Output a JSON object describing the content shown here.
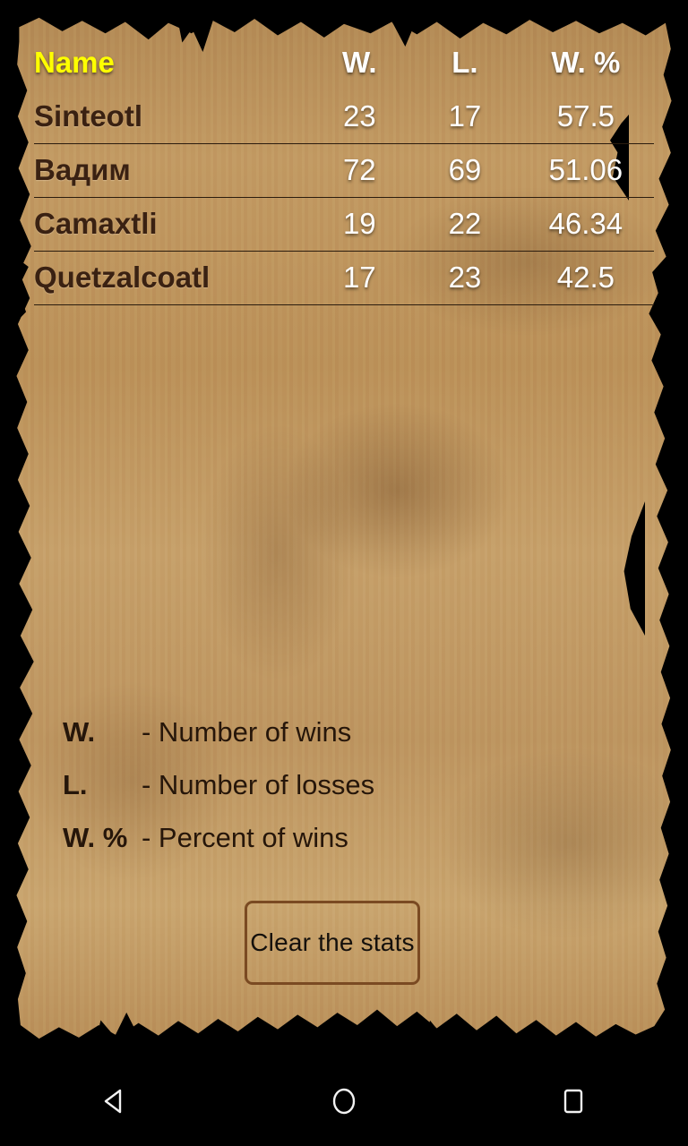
{
  "table": {
    "columns": [
      {
        "key": "name",
        "label": "Name",
        "accent": "#ffff00"
      },
      {
        "key": "w",
        "label": "W."
      },
      {
        "key": "l",
        "label": "L."
      },
      {
        "key": "pct",
        "label": "W. %"
      }
    ],
    "rows": [
      {
        "name": "Sinteotl",
        "w": "23",
        "l": "17",
        "pct": "57.5"
      },
      {
        "name": "Вадим",
        "w": "72",
        "l": "69",
        "pct": "51.06"
      },
      {
        "name": "Camaxtli",
        "w": "19",
        "l": "22",
        "pct": "46.34"
      },
      {
        "name": "Quetzalcoatl",
        "w": "17",
        "l": "23",
        "pct": "42.5"
      }
    ]
  },
  "legend": [
    {
      "key": "W.",
      "desc": "- Number of wins"
    },
    {
      "key": "L.",
      "desc": "- Number of losses"
    },
    {
      "key": "W. %",
      "desc": "- Percent of wins"
    }
  ],
  "actions": {
    "clear_stats_label": "Clear the stats"
  },
  "nav_bar": {
    "back": "back-icon",
    "home": "home-icon",
    "recents": "recents-icon"
  },
  "colors": {
    "header_accent": "#ffff00",
    "name_text": "#3a2112",
    "number_text": "#ffffff",
    "legend_text": "#26160a",
    "button_border": "#7a4a22",
    "parchment": "#bd9460",
    "background": "#000000"
  }
}
